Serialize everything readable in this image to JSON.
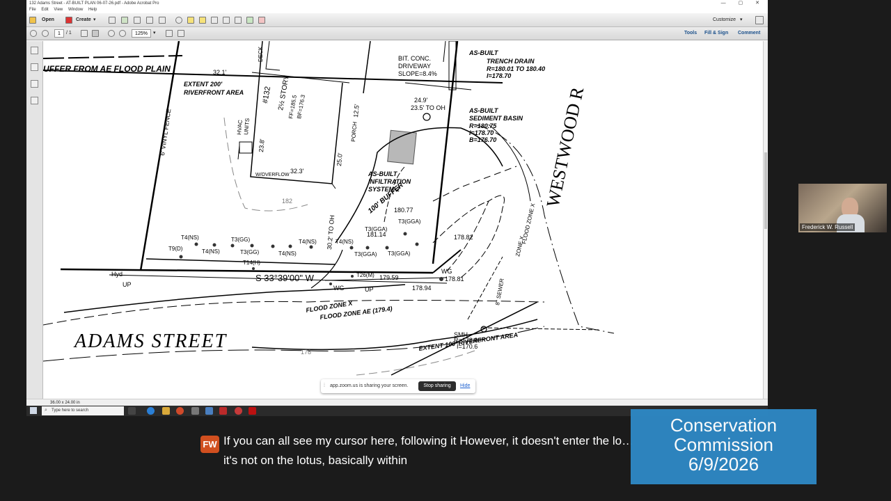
{
  "window": {
    "title": "132 Adams Street - AT-BUILT PLAN 06-07-26.pdf - Adobe Acrobat Pro",
    "controls": "— ▢ ✕"
  },
  "menu": [
    "File",
    "Edit",
    "View",
    "Window",
    "Help"
  ],
  "toolbar": {
    "open_label": "Open",
    "create_label": "Create",
    "customize_label": "Customize"
  },
  "nav": {
    "page_current": "1",
    "page_total": "/ 1",
    "zoom": "125%",
    "tools_label": "Tools",
    "fill_sign_label": "Fill & Sign",
    "comment_label": "Comment"
  },
  "status": {
    "page_size": "36.00 x 24.00 in"
  },
  "taskbar": {
    "search_placeholder": "Type here to search"
  },
  "plan": {
    "buffer_flood": "UFFER FROM AE FLOOD PLAIN",
    "riverfront_200": "EXTENT 200'",
    "riverfront_area": "RIVERFRONT AREA",
    "house_number": "#132",
    "story": "2½ STORY",
    "ff": "FF=185.5",
    "bf": "BF=176.3",
    "deck": "DECK",
    "hvac": "HVAC",
    "units": "UNITS",
    "porch": "PORCH",
    "driveway1": "BIT. CONC.",
    "driveway2": "DRIVEWAY",
    "driveway3": "SLOPE=8.4%",
    "trench1": "AS-BUILT",
    "trench2": "TRENCH DRAIN",
    "trench3": "R=180.01 TO 180.40",
    "trench4": "I=178.70",
    "basin1": "AS-BUILT",
    "basin2": "SEDIMENT BASIN",
    "basin3": "R=180.75",
    "basin4": "I=178.70",
    "basin5": "B=176.70",
    "infil1": "AS-BUILT",
    "infil2": "INFILTRATION",
    "infil3": "SYSTEM-2",
    "westwood": "WESTWOOD R",
    "adams": "ADAMS  STREET",
    "buffer100": "100' BUFFER",
    "fence": "6' VINYL FENCE",
    "bearing": "S 33°39'00\" W",
    "flood_x": "FLOOD ZONE X",
    "flood_ae": "FLOOD ZONE AE (179.4)",
    "zone_x": "ZONE X",
    "flood_zone_x2": "FLOOD ZONE X",
    "sewer": "8\" SEWER",
    "smh1": "SMH",
    "smh2": "R=178.80",
    "smh3": "I=170.6",
    "riverfront_100": "EXTENT 100' RIVERFRONT AREA",
    "overflow": "W/OVERFLOW",
    "dim_32_3": "32.3'",
    "dim_32_1": "32.1'",
    "dim_25": "25.0'",
    "dim_24_9": "24.9'",
    "dim_23_5": "23.5' TO OH",
    "dim_30_2": "30.2' TO OH",
    "dim_23_8": "23.8'",
    "dim_12_5": "12.5'",
    "e_178_82": "178.82",
    "e_178_81": "178.81",
    "e_178_94": "178.94",
    "e_179_59": "179.59",
    "e_180_77": "180.77",
    "e_181_14": "181.14",
    "wg": "WG",
    "up": "UP",
    "hyd": "Hyd",
    "contour_182": "182",
    "contour_178": "178",
    "trees": [
      "T4(NS)",
      "T3(GG)",
      "T9(D)",
      "T4(NS)",
      "T3(GG)",
      "T4(NS)",
      "T4(NS)",
      "T14(H)",
      "T3(GGA)",
      "T3(GGA)",
      "T4(NS)",
      "T3(GGA)",
      "T26(M)",
      "T3(GGA)"
    ]
  },
  "share": {
    "message": "app.zoom.us is sharing your screen.",
    "stop_label": "Stop sharing",
    "hide_label": "Hide"
  },
  "video": {
    "participant": "Frederick W. Russell"
  },
  "caption": {
    "initials": "FW",
    "text": "If you can all see my cursor here, following it However, it doesn't enter the lo… it's not on the lotus, basically within"
  },
  "badge": {
    "line1": "Conservation",
    "line2": "Commission",
    "line3": "6/9/2026"
  },
  "colors": {
    "badge_bg": "#2e86c1",
    "avatar_bg": "#d14f1f",
    "stop_btn": "#2d2d2d"
  }
}
